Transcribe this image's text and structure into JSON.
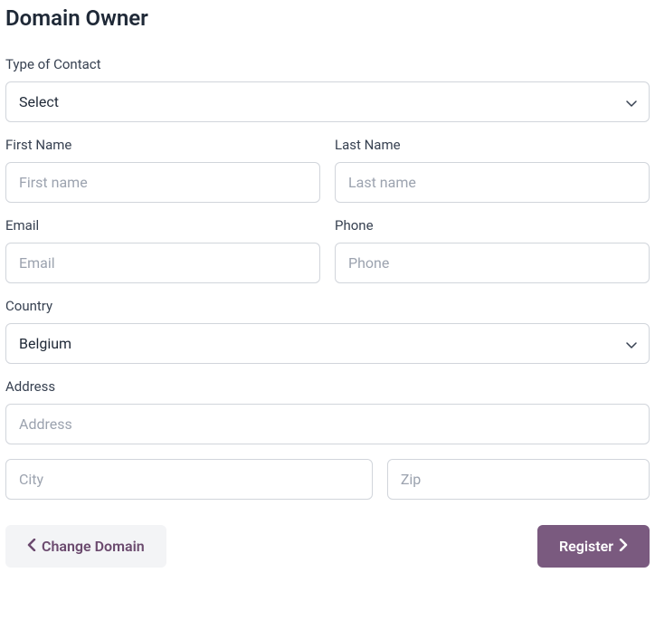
{
  "title": "Domain Owner",
  "fields": {
    "contact_type": {
      "label": "Type of Contact",
      "value": "Select"
    },
    "first_name": {
      "label": "First Name",
      "placeholder": "First name",
      "value": ""
    },
    "last_name": {
      "label": "Last Name",
      "placeholder": "Last name",
      "value": ""
    },
    "email": {
      "label": "Email",
      "placeholder": "Email",
      "value": ""
    },
    "phone": {
      "label": "Phone",
      "placeholder": "Phone",
      "value": ""
    },
    "country": {
      "label": "Country",
      "value": "Belgium"
    },
    "address": {
      "label": "Address",
      "placeholder": "Address",
      "value": ""
    },
    "city": {
      "placeholder": "City",
      "value": ""
    },
    "zip": {
      "placeholder": "Zip",
      "value": ""
    }
  },
  "buttons": {
    "change_domain": "Change Domain",
    "register": "Register"
  }
}
